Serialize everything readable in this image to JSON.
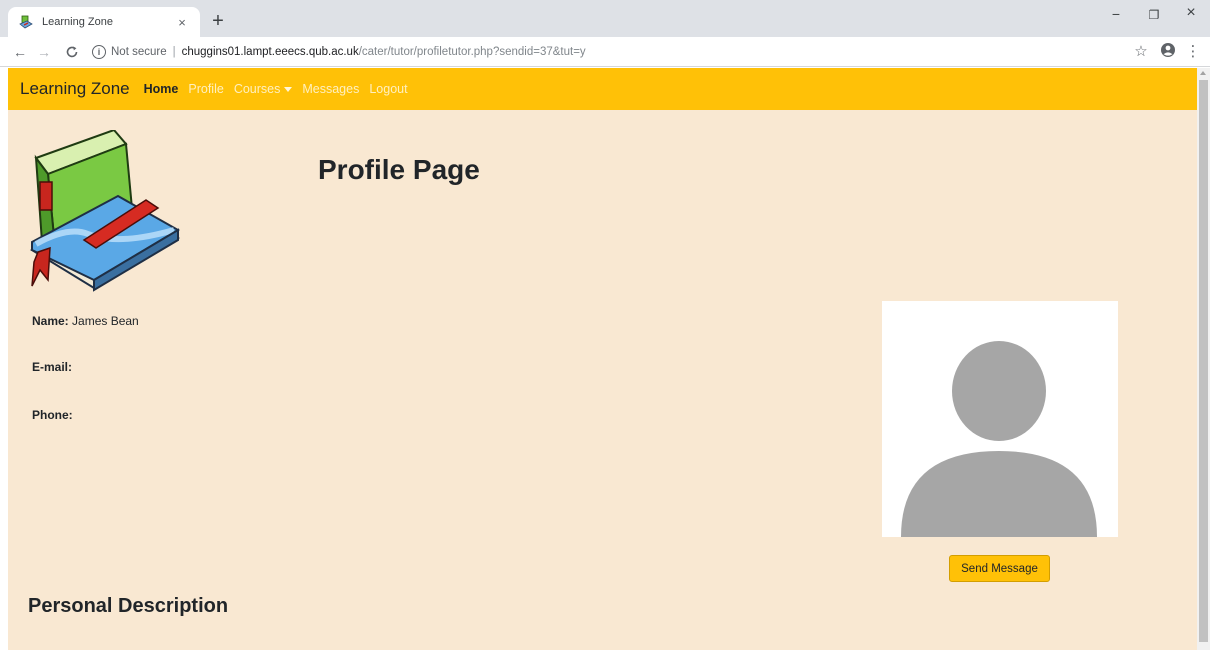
{
  "browser": {
    "tab_title": "Learning Zone",
    "tab_close": "×",
    "new_tab": "+",
    "window_controls": {
      "minimize": "−",
      "restore": "❐",
      "close": "×"
    },
    "omnibox": {
      "security_label": "Not secure",
      "separator": "|",
      "host": "chuggins01.lampt.eeecs.qub.ac.uk",
      "path": "/cater/tutor/profiletutor.php?sendid=37&tut=y"
    },
    "icons": {
      "back": "←",
      "forward": "→",
      "reload": "C",
      "star": "☆",
      "profile": "⊖",
      "menu": "⋮"
    }
  },
  "navbar": {
    "brand": "Learning Zone",
    "links": [
      {
        "label": "Home",
        "active": true
      },
      {
        "label": "Profile",
        "active": false
      },
      {
        "label": "Courses",
        "active": false,
        "dropdown": true
      },
      {
        "label": "Messages",
        "active": false
      },
      {
        "label": "Logout",
        "active": false
      }
    ]
  },
  "main": {
    "title": "Profile Page",
    "fields": {
      "name_label": "Name:",
      "name_value": "James Bean",
      "email_label": "E-mail:",
      "email_value": "",
      "phone_label": "Phone:",
      "phone_value": ""
    },
    "send_button": "Send Message",
    "section_title": "Personal Description"
  },
  "colors": {
    "navbar_bg": "#ffc107",
    "page_bg": "#f9e8d2",
    "avatar_gray": "#a6a6a6"
  }
}
